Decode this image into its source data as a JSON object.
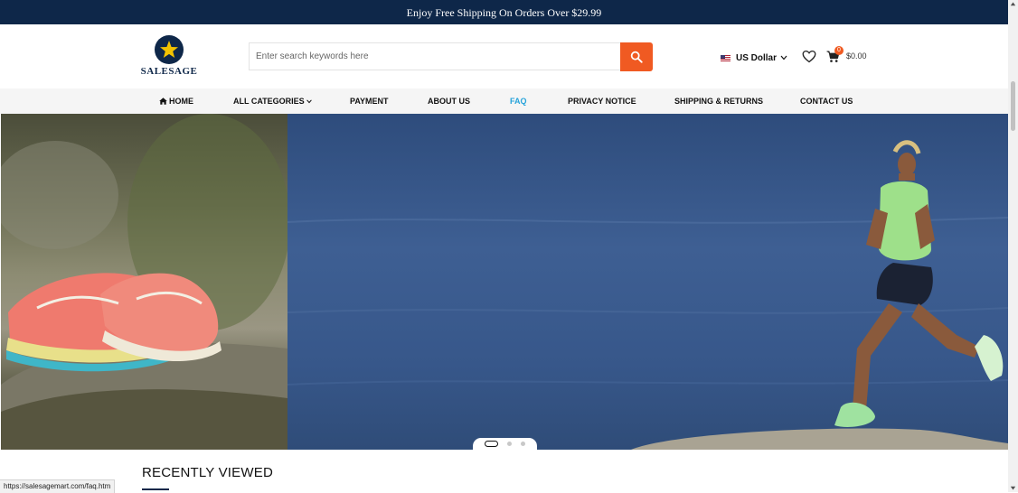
{
  "topbar": {
    "message": "Enjoy Free Shipping On Orders Over $29.99"
  },
  "logo": {
    "text": "SALESAGE",
    "icon": "star-icon"
  },
  "search": {
    "placeholder": "Enter search keywords here",
    "value": "",
    "button_icon": "search-icon"
  },
  "currency": {
    "label": "US Dollar",
    "flag_icon": "us-flag-icon"
  },
  "cart": {
    "count": "0",
    "total": "$0.00",
    "icon": "cart-icon"
  },
  "wishlist": {
    "icon": "heart-icon"
  },
  "nav": {
    "home": "HOME",
    "all_categories": "ALL CATEGORIES",
    "payment": "PAYMENT",
    "about_us": "ABOUT US",
    "faq": "FAQ",
    "privacy_notice": "PRIVACY NOTICE",
    "shipping_returns": "SHIPPING & RETURNS",
    "contact_us": "CONTACT US",
    "active": "FAQ"
  },
  "carousel": {
    "slides": 3,
    "active_slide": 1
  },
  "recently_viewed": {
    "title": "RECENTLY VIEWED"
  },
  "status_bar": {
    "url": "https://salesagemart.com/faq.htm"
  },
  "colors": {
    "topbar_bg": "#0e2749",
    "accent": "#f05a22",
    "nav_active": "#26a3da",
    "nav_bg": "#f5f5f5"
  }
}
